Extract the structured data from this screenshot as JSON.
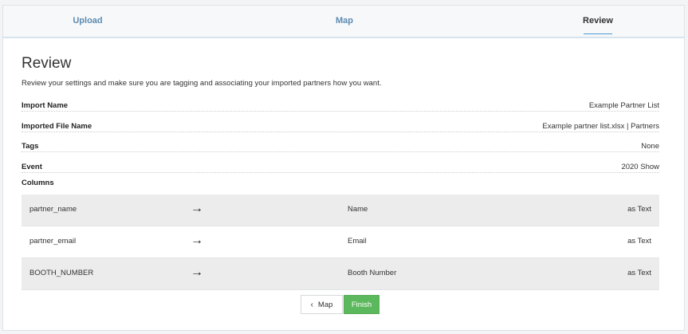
{
  "tabs": [
    {
      "label": "Upload"
    },
    {
      "label": "Map"
    },
    {
      "label": "Review"
    }
  ],
  "active_tab": "Review",
  "review": {
    "title": "Review",
    "description": "Review your settings and make sure you are tagging and associating your imported partners how you want.",
    "fields": [
      {
        "label": "Import Name",
        "value": "Example Partner List"
      },
      {
        "label": "Imported File Name",
        "value": "Example partner list.xlsx | Partners"
      },
      {
        "label": "Tags",
        "value": "None"
      },
      {
        "label": "Event",
        "value": "2020 Show"
      }
    ],
    "columns_label": "Columns",
    "columns": [
      {
        "source": "partner_name",
        "arrow": "→",
        "target": "Name",
        "type": "as Text"
      },
      {
        "source": "partner_email",
        "arrow": "→",
        "target": "Email",
        "type": "as Text"
      },
      {
        "source": "BOOTH_NUMBER",
        "arrow": "→",
        "target": "Booth Number",
        "type": "as Text"
      }
    ]
  },
  "buttons": {
    "back_icon": "‹",
    "back_label": "Map",
    "finish_label": "Finish"
  },
  "colors": {
    "finish_button": "#5cb85c",
    "tab_link": "#5b8bb2",
    "active_underline": "#4a9bd9"
  }
}
